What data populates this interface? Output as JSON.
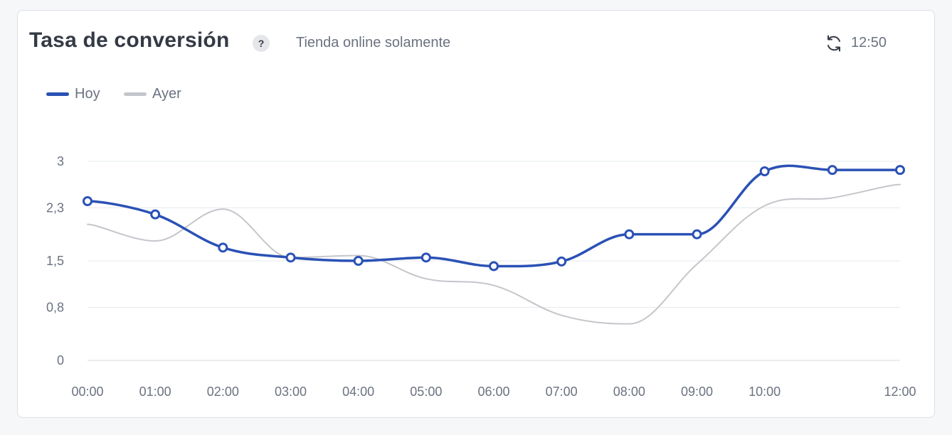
{
  "header": {
    "title": "Tasa de conversión",
    "help_label": "?",
    "subtitle": "Tienda online solamente",
    "refresh_icon": "refresh-icon",
    "time": "12:50"
  },
  "legend": [
    {
      "name": "Hoy",
      "color": "#2a51b5"
    },
    {
      "name": "Ayer",
      "color": "#c4c6cb"
    }
  ],
  "chart_data": {
    "type": "line",
    "title": "Tasa de conversión",
    "x": [
      "00:00",
      "01:00",
      "02:00",
      "03:00",
      "04:00",
      "05:00",
      "06:00",
      "07:00",
      "08:00",
      "09:00",
      "10:00",
      "11:00",
      "12:00"
    ],
    "x_tick_labels": [
      "00:00",
      "01:00",
      "02:00",
      "03:00",
      "04:00",
      "05:00",
      "06:00",
      "07:00",
      "08:00",
      "09:00",
      "10:00",
      "12:00"
    ],
    "y_ticks": [
      0,
      0.8,
      1.5,
      2.3,
      3
    ],
    "y_tick_labels": [
      "0",
      "0,8",
      "1,5",
      "2,3",
      "3"
    ],
    "ylim": [
      0,
      3
    ],
    "grid": true,
    "legend_position": "top-left",
    "series": [
      {
        "name": "Hoy",
        "color": "#2a51b5",
        "markers": true,
        "values": [
          2.4,
          2.2,
          1.7,
          1.55,
          1.5,
          1.55,
          1.42,
          1.49,
          1.9,
          1.9,
          2.85,
          2.87,
          2.87
        ]
      },
      {
        "name": "Ayer",
        "color": "#c4c6cb",
        "markers": false,
        "values": [
          2.05,
          1.8,
          2.28,
          1.55,
          1.58,
          1.23,
          1.13,
          0.68,
          0.55,
          1.45,
          2.33,
          2.45,
          2.65
        ]
      }
    ]
  }
}
